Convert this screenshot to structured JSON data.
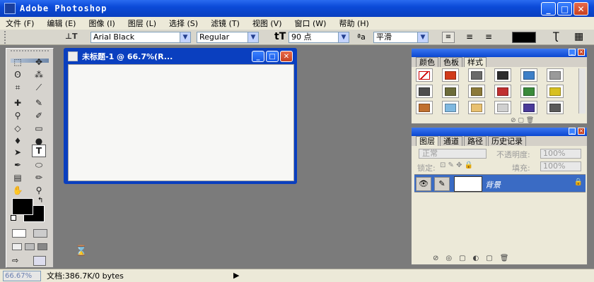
{
  "window": {
    "title": "Adobe Photoshop",
    "controls": [
      "_",
      "□",
      "✕"
    ]
  },
  "menu": [
    "文件 (F)",
    "编辑 (E)",
    "图像 (I)",
    "图层 (L)",
    "选择 (S)",
    "滤镜 (T)",
    "视图 (V)",
    "窗口 (W)",
    "帮助 (H)"
  ],
  "options": {
    "font_family": "Arial Black",
    "font_style": "Regular",
    "font_size": "90 点",
    "aa_label": "ªa",
    "antialias": "平滑"
  },
  "document": {
    "title": "未标题-1 @ 66.7%(R..."
  },
  "styles_panel": {
    "tabs": [
      "颜色",
      "色板",
      "样式"
    ],
    "swatch_colors": [
      "#ffffff",
      "#d13a1a",
      "#6a6a6a",
      "#2d2d2d",
      "#3d7fc8",
      "#9a9a9a",
      "#4d4d4d",
      "#6b6b3a",
      "#8c7a3a",
      "#c03030",
      "#3a8a3a",
      "#d8c020",
      "#c07030",
      "#7fb8e0",
      "#e8c070",
      "#d0d0d0",
      "#4a3a9a",
      "#5a5a5a"
    ]
  },
  "layers_panel": {
    "tabs": [
      "图层",
      "通道",
      "路径",
      "历史记录"
    ],
    "blend_mode": "正常",
    "opacity_label": "不透明度:",
    "opacity_value": "100%",
    "lock_label": "锁定:",
    "fill_label": "填充:",
    "fill_value": "100%",
    "layer_name": "背景"
  },
  "status": {
    "zoom": "66.67%",
    "doc_info": "文档:386.7K/0 bytes"
  },
  "colors": {
    "title_blue": "#0b4ad8",
    "workspace_gray": "#7b7b7b",
    "layer_selected": "#3a6bc4"
  }
}
